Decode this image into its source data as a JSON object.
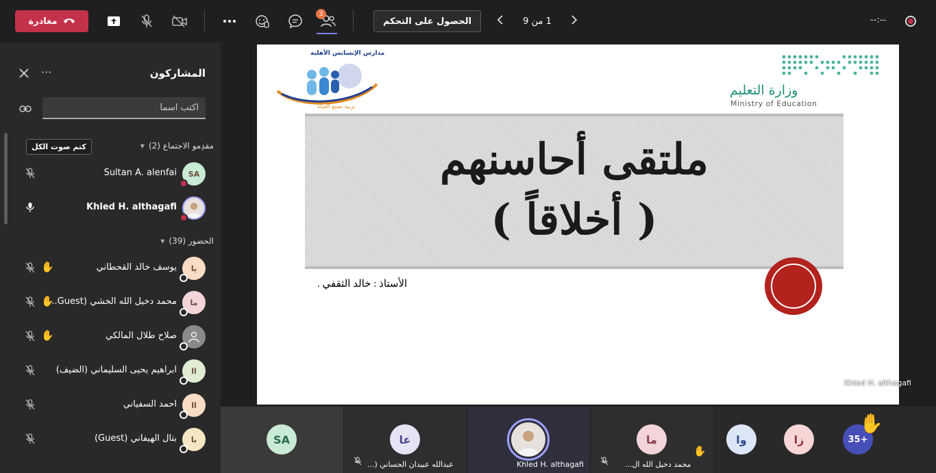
{
  "topbar": {
    "leave_label": "مغادرة",
    "control_label": "الحصول على التحكم",
    "pager_text": "1 من 9",
    "timer": "--:--",
    "participants_badge": "3",
    "icons": [
      "share-tray-icon",
      "mic-off-icon",
      "camera-off-icon",
      "more-icon",
      "reactions-icon",
      "chat-icon",
      "participants-icon",
      "prev-page-icon",
      "next-page-icon",
      "record-icon"
    ]
  },
  "sidebar": {
    "title": "المشاركون",
    "search_placeholder": "اكتب اسماً",
    "organizers_title": "مقدِمو الاجتماع (2)",
    "mute_all_label": "كتم صوت الكل",
    "attendees_title": "الحضور (39)",
    "organizers": [
      {
        "name": "Sultan A. alenfai",
        "initials": "SA",
        "avatar_color": "#c9ead4",
        "status_color": "#c4314b",
        "mic": "mic-off-icon"
      },
      {
        "name": "Khled H. althagafi",
        "initials": "",
        "avatar_color": "#e6e1dc",
        "status_color": "#c4314b",
        "mic": "mic-on-icon"
      }
    ],
    "attendees": [
      {
        "name": "يوسف خالد القحطاني",
        "initials": "يا",
        "avatar_color": "#f8dcc4",
        "hand": true
      },
      {
        "name": "محمد دخيل الله الخشي (Guest...",
        "initials": "ما",
        "avatar_color": "#f3d5d9",
        "hand": true
      },
      {
        "name": "صلاح طلال المالكي",
        "initials": "",
        "avatar_color": "#8a8a8a",
        "hand": true
      },
      {
        "name": "ابراهيم يحيى السليماني (الضيف)",
        "initials": "اا",
        "avatar_color": "#e0ecd4",
        "hand": false
      },
      {
        "name": "احمد السفياني",
        "initials": "اا",
        "avatar_color": "#f8dcc4",
        "hand": false
      },
      {
        "name": "بتال الهيفاني (Guest)",
        "initials": "با",
        "avatar_color": "#f6e7c4",
        "hand": false
      }
    ]
  },
  "slide": {
    "moe_ar": "وزارة التعليم",
    "moe_en": "Ministry of Education",
    "school_logo_text": "مدارس الإنسانس الأهلية",
    "school_logo_tagline": "تربية تصنع الحياة",
    "title_line1": "ملتقى أحاسنهم",
    "title_line2": "( أخلاقاً )",
    "teacher": "الأستاذ : خالد الثقفي .",
    "presenter_tag": "Khled H. althagafi"
  },
  "gallery": {
    "tiles": [
      {
        "initials": "SA",
        "name": "",
        "avatar_color": "#c9ead4"
      },
      {
        "initials": "عا",
        "name": "عبدالله عبيدان الحساني (...",
        "avatar_color": "#e6e3f5"
      },
      {
        "initials": "",
        "name": "Khled H. althagafi",
        "avatar_color": "#e6e1dc"
      },
      {
        "initials": "ما",
        "name": "محمد دخيل الله ال...",
        "avatar_color": "#f3d5d9"
      },
      {
        "initials": "وا",
        "name": "",
        "avatar_color": "#dde6f6"
      },
      {
        "initials": "زا",
        "name": "",
        "avatar_color": "#f8d6d6"
      }
    ],
    "overflow_count": "35+"
  }
}
